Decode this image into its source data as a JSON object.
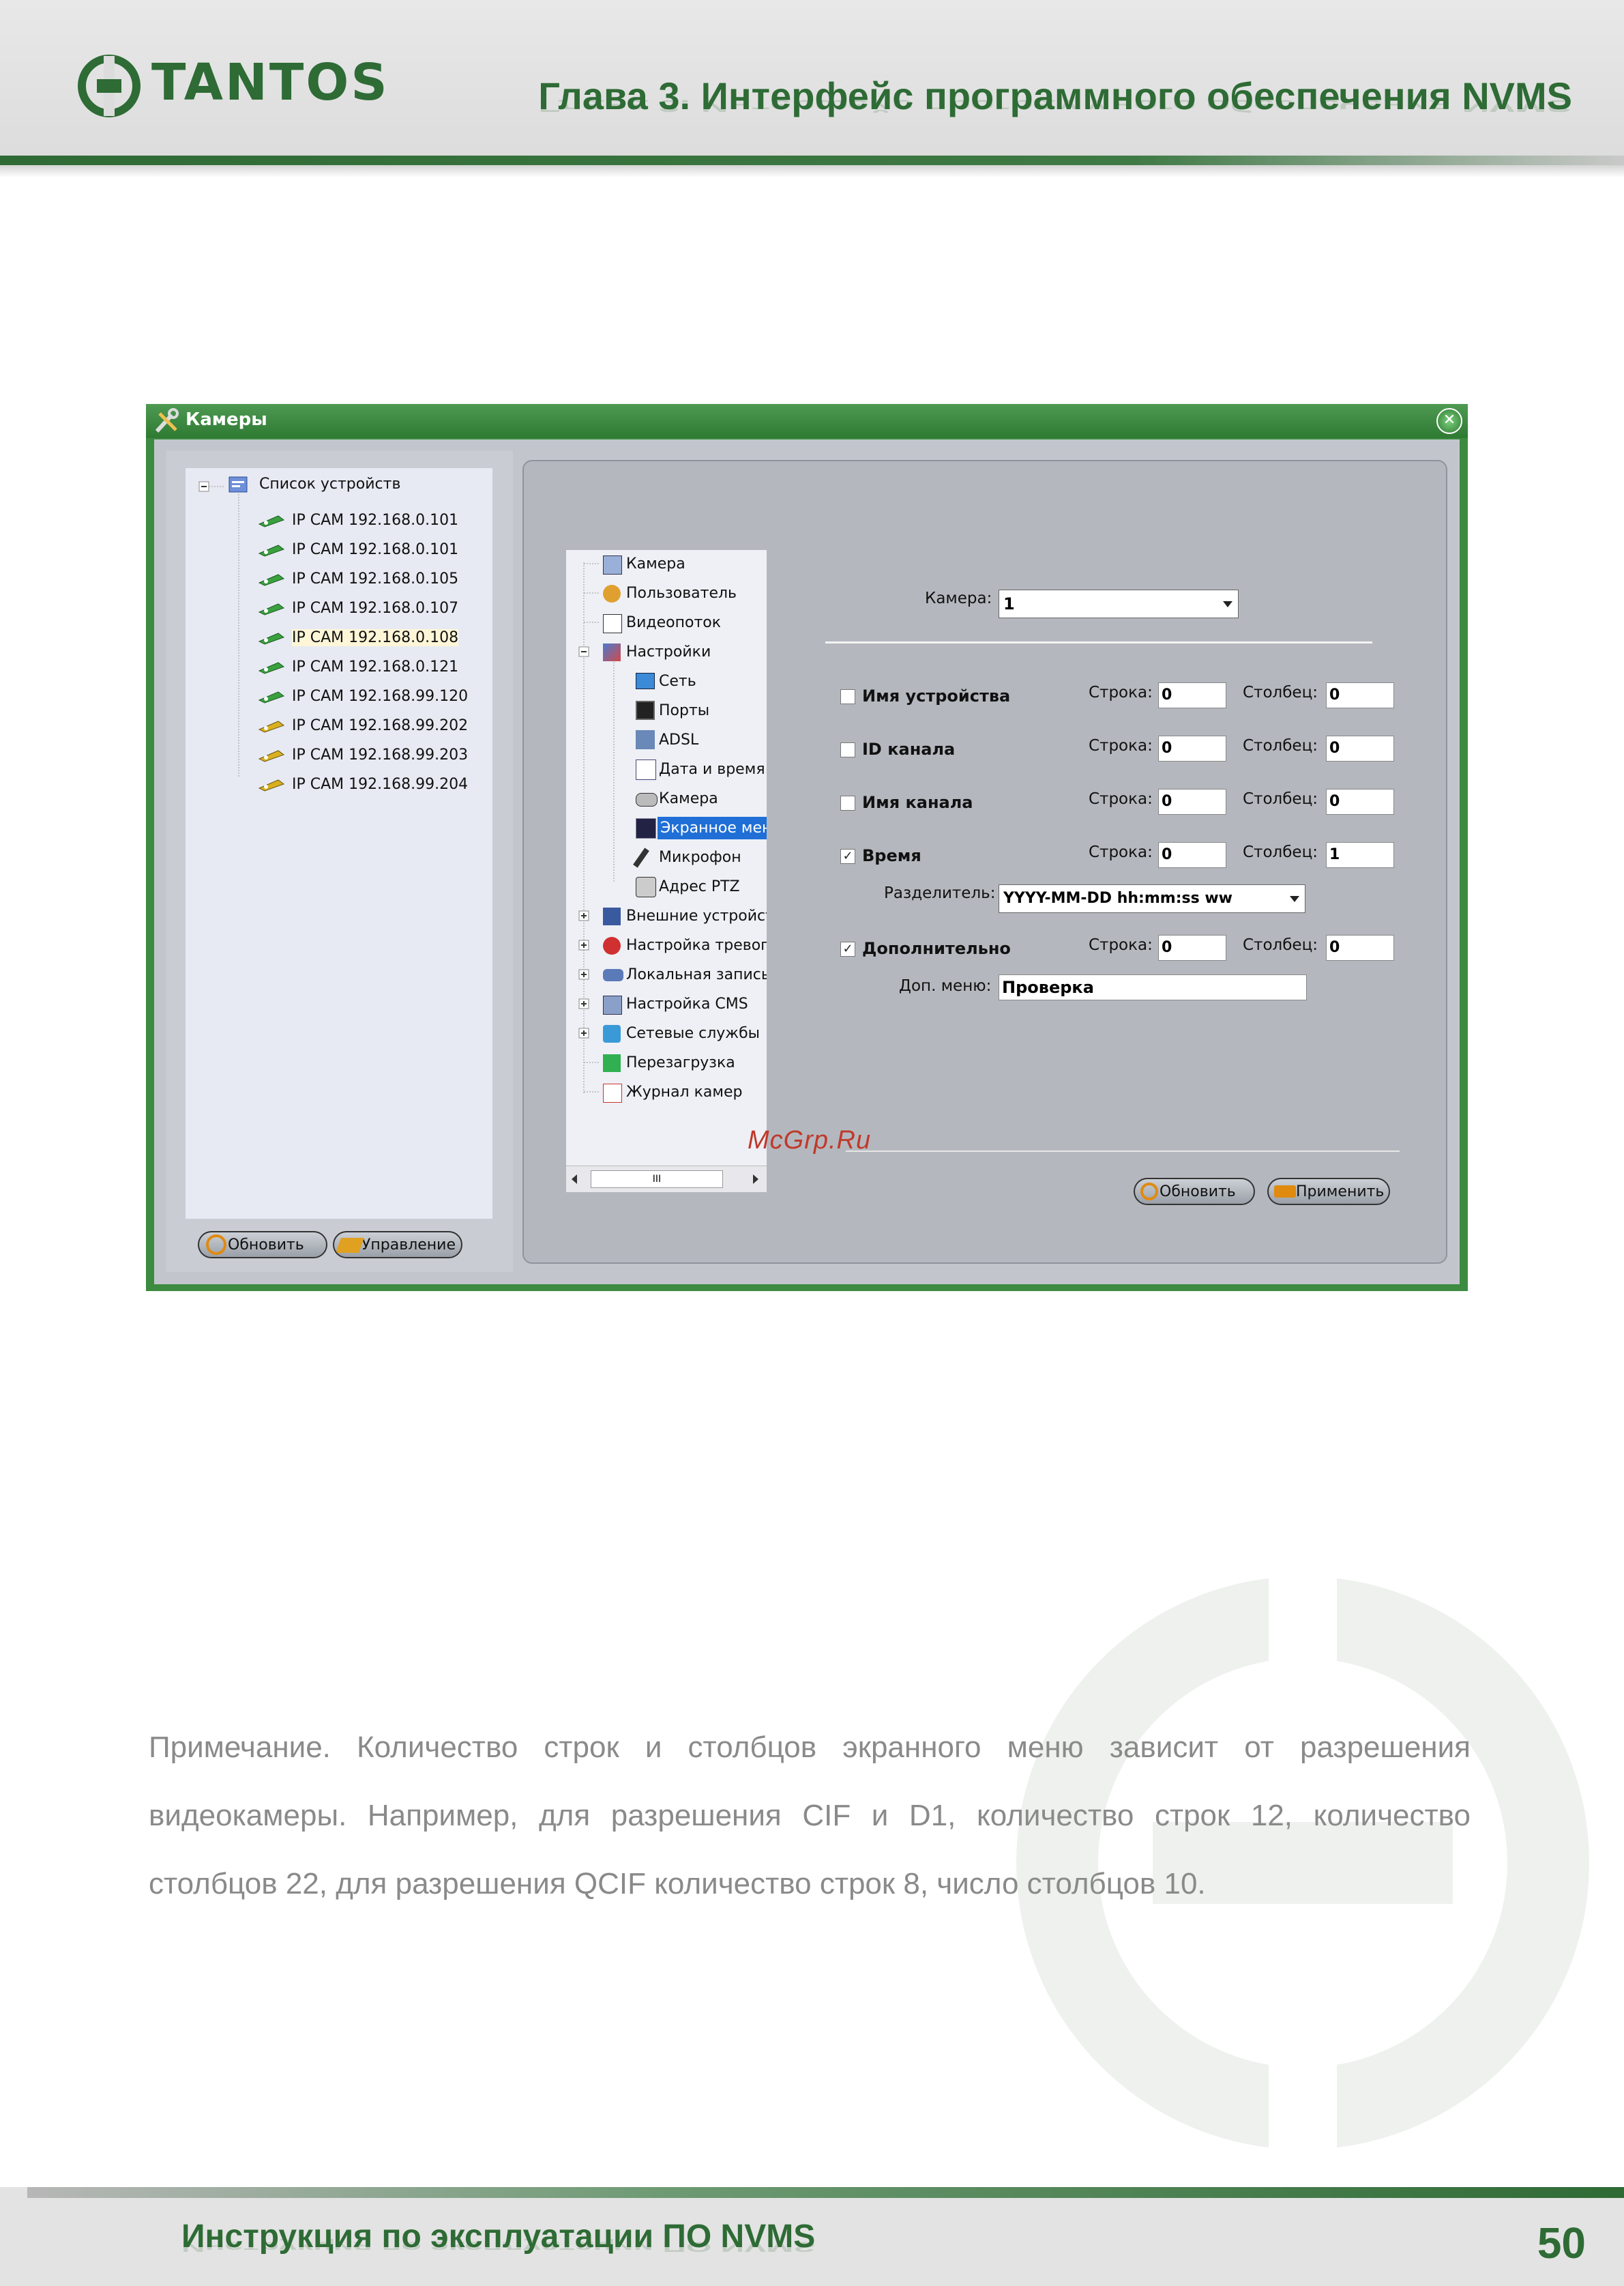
{
  "header": {
    "logo_text": "TANTOS",
    "chapter_title": "Глава 3. Интерфейс программного обеспечения NVMS"
  },
  "window": {
    "title": "Камеры",
    "close_glyph": "✕",
    "device_tree": {
      "root": "Список устройств",
      "items": [
        "IP CAM 192.168.0.101",
        "IP CAM 192.168.0.101",
        "IP CAM 192.168.0.105",
        "IP CAM 192.168.0.107",
        "IP CAM 192.168.0.108",
        "IP CAM 192.168.0.121",
        "IP CAM 192.168.99.120",
        "IP CAM 192.168.99.202",
        "IP CAM 192.168.99.203",
        "IP CAM 192.168.99.204"
      ]
    },
    "left_buttons": {
      "refresh": "Обновить",
      "manage": "Управление"
    },
    "settings_tree": [
      "Камера",
      "Пользователь",
      "Видеопоток",
      "Настройки",
      "Сеть",
      "Порты",
      "ADSL",
      "Дата и время",
      "Камера",
      "Экранное меню",
      "Микрофон",
      "Адрес PTZ",
      "Внешние устройства",
      "Настройка тревог",
      "Локальная запись",
      "Настройка CMS",
      "Сетевые службы",
      "Перезагрузка",
      "Журнал камер"
    ],
    "scroll_thumb_glyph": "III",
    "form": {
      "camera_label": "Камера:",
      "camera_value": "1",
      "row_label": "Строка:",
      "col_label": "Столбец:",
      "rows": [
        {
          "label": "Имя устройства",
          "checked": "",
          "row": "0",
          "col": "0"
        },
        {
          "label": "ID канала",
          "checked": "",
          "row": "0",
          "col": "0"
        },
        {
          "label": "Имя канала",
          "checked": "",
          "row": "0",
          "col": "0"
        },
        {
          "label": "Время",
          "checked": "✓",
          "row": "0",
          "col": "1"
        },
        {
          "label": "Дополнительно",
          "checked": "✓",
          "row": "0",
          "col": "0"
        }
      ],
      "separator_label": "Разделитель:",
      "separator_value": "YYYY-MM-DD hh:mm:ss ww",
      "extra_menu_label": "Доп. меню:",
      "extra_menu_value": "Проверка",
      "refresh_button": "Обновить",
      "apply_button": "Применить"
    }
  },
  "watermark_text": "McGrp.Ru",
  "note": {
    "line1": "Примечание. Количество строк и столбцов экранного меню зависит от разрешения",
    "line2": "видеокамеры. Например, для разрешения CIF и D1, количество строк 12, количество",
    "line3": "столбцов 22, для разрешения QCIF количество строк 8, число столбцов 10."
  },
  "footer": {
    "text": "Инструкция по эксплуатации ПО NVMS",
    "page_number": "50"
  },
  "colors": {
    "brand_green": "#2e6b35",
    "window_green": "#3d8a41",
    "selection_blue": "#1f6fd6"
  }
}
